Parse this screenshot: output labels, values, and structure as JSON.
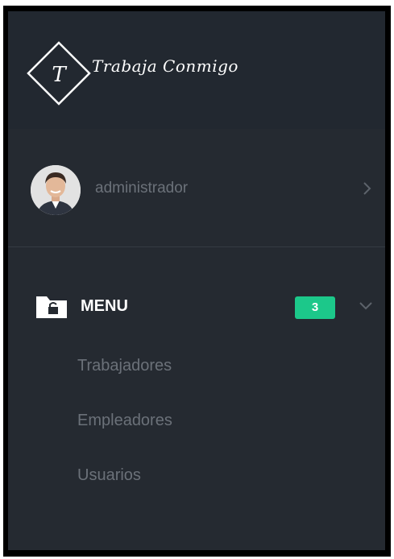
{
  "brand": {
    "logo_letter": "T",
    "title": "Trabaja Conmigo"
  },
  "user": {
    "name": "administrador"
  },
  "menu": {
    "label": "MENU",
    "badge": "3",
    "items": [
      {
        "label": "Trabajadores"
      },
      {
        "label": "Empleadores"
      },
      {
        "label": "Usuarios"
      }
    ]
  },
  "colors": {
    "sidebar_bg": "#252a31",
    "badge_bg": "#1cc88a",
    "muted_text": "#6b7179"
  }
}
